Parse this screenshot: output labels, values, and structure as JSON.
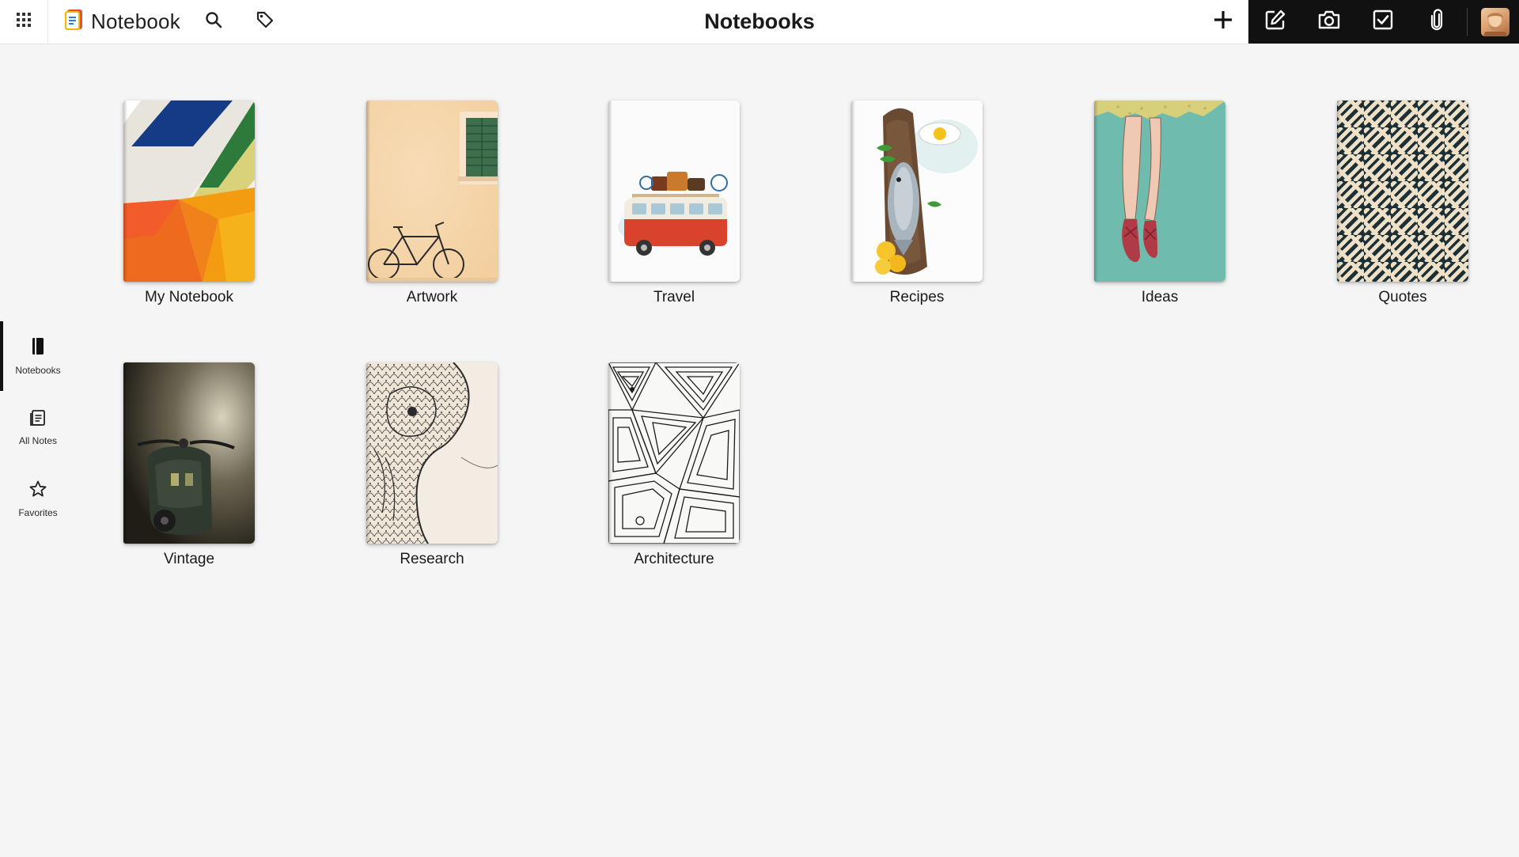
{
  "app": {
    "name": "Notebook",
    "page_title": "Notebooks"
  },
  "topbar": {
    "icons": [
      "apps-grid-icon",
      "notebook-logo-icon",
      "search-icon",
      "tag-icon",
      "plus-icon"
    ],
    "tools": [
      "edit-note-icon",
      "camera-icon",
      "checklist-icon",
      "paperclip-icon"
    ],
    "dark_toolbar_color": "#111111"
  },
  "sidebar": {
    "items": [
      {
        "label": "Notebooks",
        "icon": "notebook-icon",
        "active": true
      },
      {
        "label": "All Notes",
        "icon": "all-notes-icon",
        "active": false
      },
      {
        "label": "Favorites",
        "icon": "star-icon",
        "active": false
      }
    ]
  },
  "notebooks": [
    {
      "title": "My Notebook",
      "cover": "geometric-color-blocks"
    },
    {
      "title": "Artwork",
      "cover": "bicycle-watercolor"
    },
    {
      "title": "Travel",
      "cover": "camper-van"
    },
    {
      "title": "Recipes",
      "cover": "fish-on-board"
    },
    {
      "title": "Ideas",
      "cover": "ballet-legs"
    },
    {
      "title": "Quotes",
      "cover": "maze-pattern"
    },
    {
      "title": "Vintage",
      "cover": "vintage-scooter"
    },
    {
      "title": "Research",
      "cover": "zentangle-elephant"
    },
    {
      "title": "Architecture",
      "cover": "line-art-spiral"
    }
  ]
}
